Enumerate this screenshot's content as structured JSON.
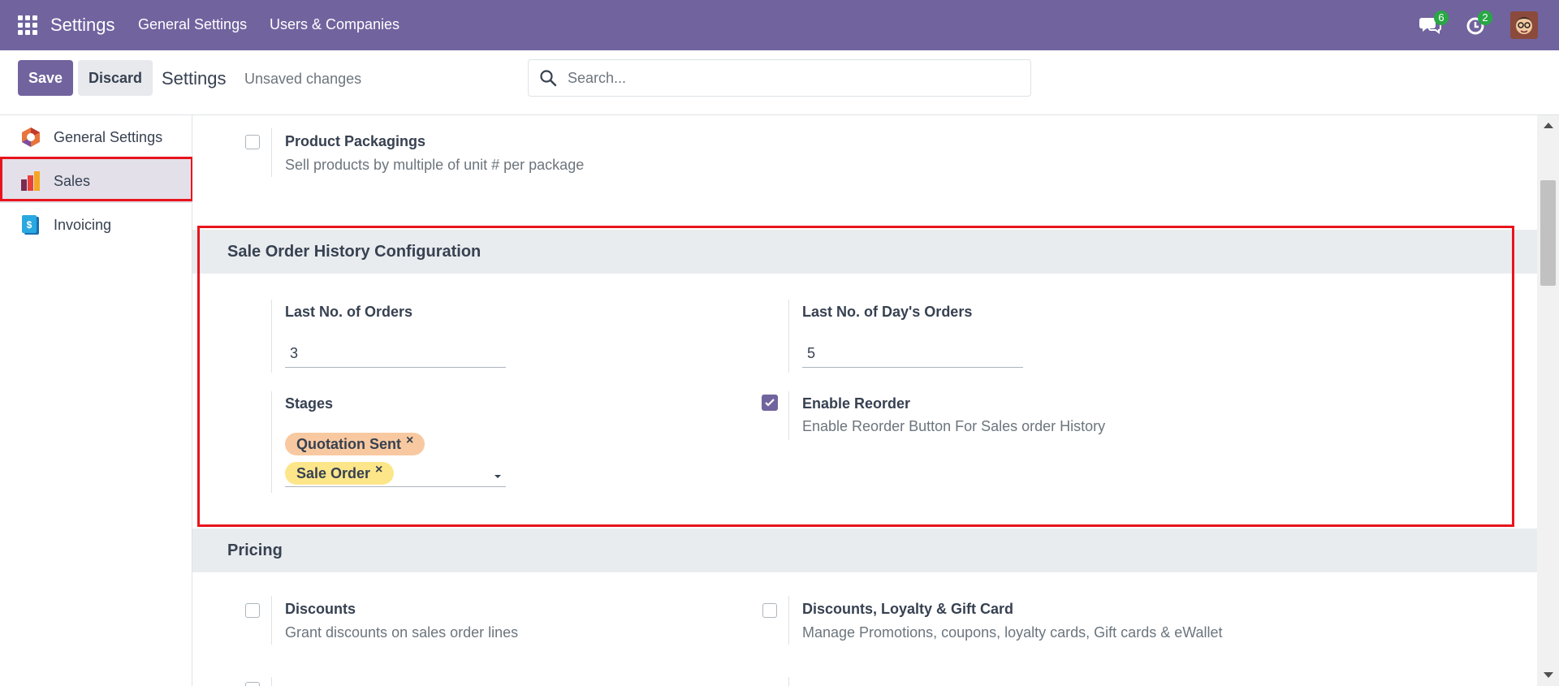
{
  "navbar": {
    "brand": "Settings",
    "menu": [
      "General Settings",
      "Users & Companies"
    ],
    "messages_count": "6",
    "activities_count": "2"
  },
  "control_panel": {
    "save_label": "Save",
    "discard_label": "Discard",
    "title": "Settings",
    "status": "Unsaved changes",
    "search_placeholder": "Search..."
  },
  "sidebar": {
    "items": [
      {
        "label": "General Settings",
        "icon": "general-settings-icon"
      },
      {
        "label": "Sales",
        "icon": "sales-icon",
        "active": true
      },
      {
        "label": "Invoicing",
        "icon": "invoicing-icon"
      }
    ]
  },
  "product_packagings": {
    "label": "Product Packagings",
    "description": "Sell products by multiple of unit # per package",
    "checked": false
  },
  "sale_order_history": {
    "title": "Sale Order History Configuration",
    "last_orders_label": "Last No. of Orders",
    "last_orders_value": "3",
    "last_days_label": "Last No. of Day's Orders",
    "last_days_value": "5",
    "stages_label": "Stages",
    "stages": [
      "Quotation Sent",
      "Sale Order"
    ],
    "enable_reorder_label": "Enable Reorder",
    "enable_reorder_description": "Enable Reorder Button For Sales order History",
    "enable_reorder_checked": true
  },
  "pricing": {
    "title": "Pricing",
    "discounts_label": "Discounts",
    "discounts_description": "Grant discounts on sales order lines",
    "loyalty_label": "Discounts, Loyalty & Gift Card",
    "loyalty_description": "Manage Promotions, coupons, loyalty cards, Gift cards & eWallet"
  },
  "colors": {
    "brand": "#71639e",
    "highlight": "#e8141c",
    "tag_quotation": "#f8c9a0",
    "tag_sale_order": "#fde68a",
    "badge": "#28a745"
  }
}
